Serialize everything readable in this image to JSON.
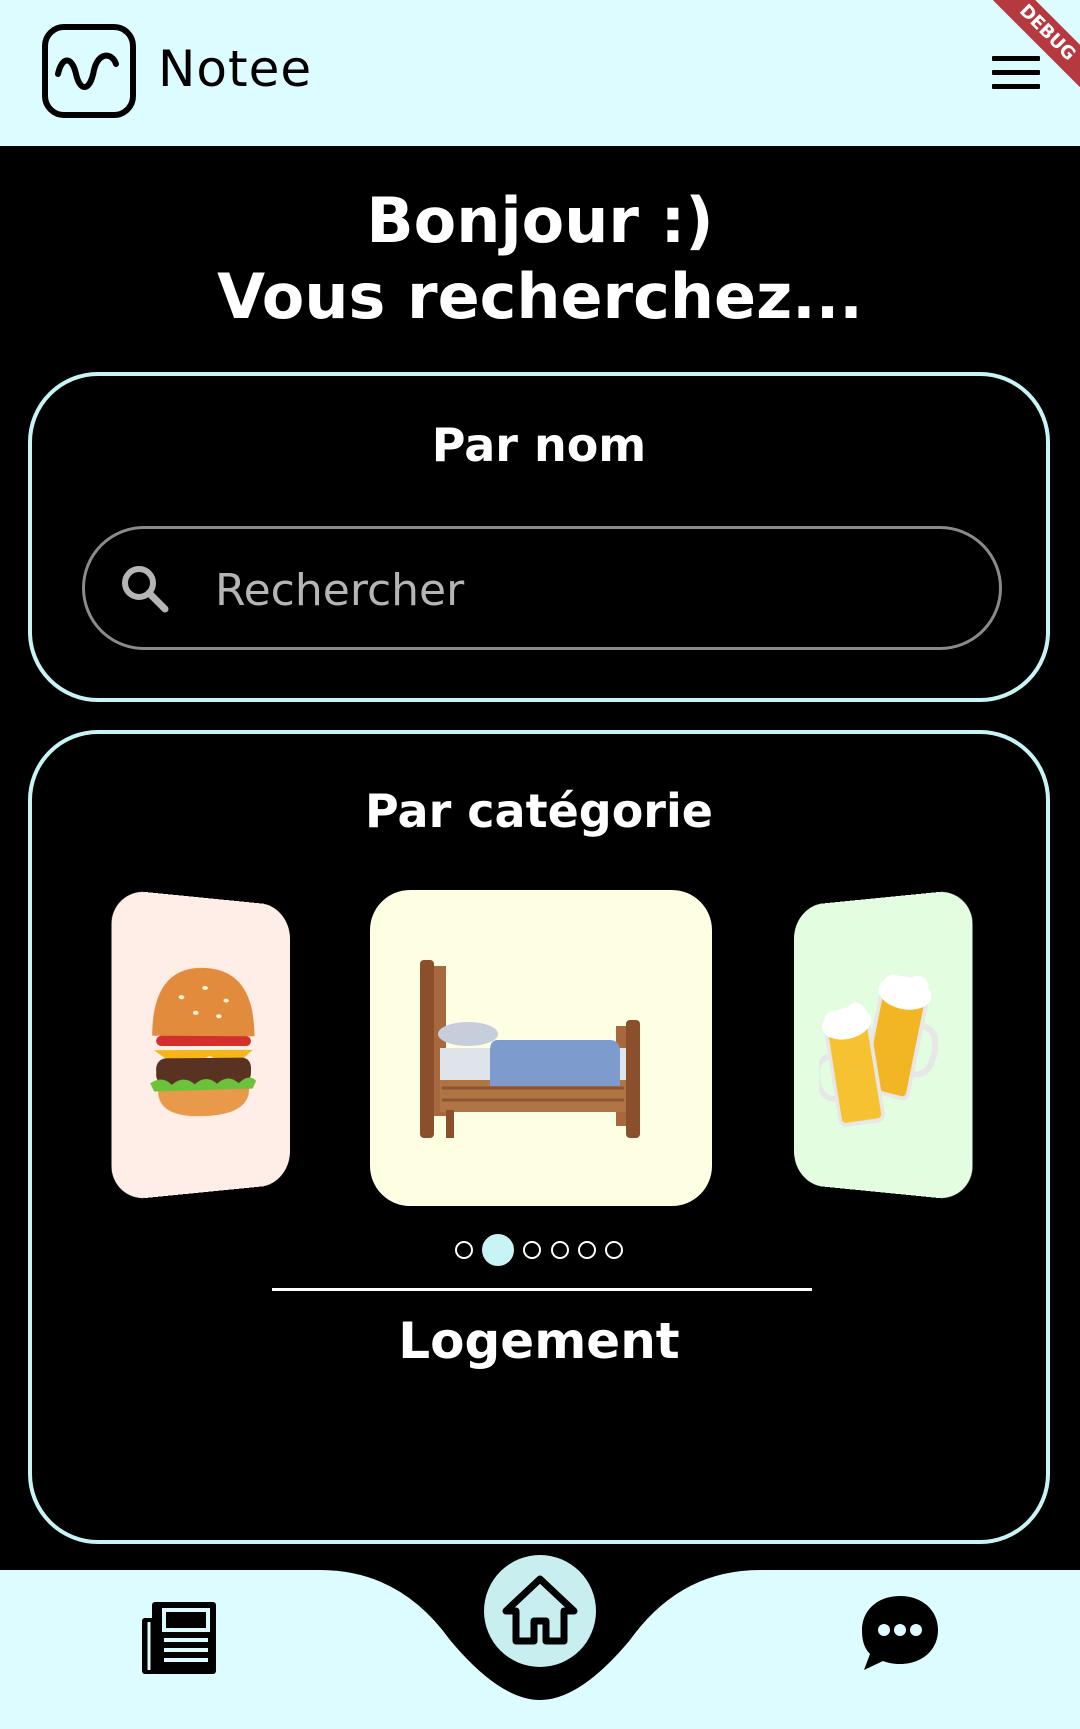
{
  "header": {
    "app_title": "Notee",
    "logo_icon": "notee-logo-icon",
    "menu_icon": "hamburger-menu-icon",
    "debug_banner": "DEBUG"
  },
  "greeting": {
    "line1": "Bonjour :)",
    "line2": "Vous recherchez..."
  },
  "search_by_name": {
    "title": "Par nom",
    "placeholder": "Rechercher",
    "value": ""
  },
  "search_by_category": {
    "title": "Par catégorie",
    "items": [
      {
        "icon": "burger-icon",
        "background": "#ffeee7"
      },
      {
        "icon": "bed-icon",
        "background": "#fefee3"
      },
      {
        "icon": "beer-mugs-icon",
        "background": "#e3fde0"
      }
    ],
    "dot_count": 6,
    "active_index": 1,
    "selected_label": "Logement"
  },
  "bottom_nav": {
    "items": [
      {
        "name": "news",
        "icon": "newspaper-icon"
      },
      {
        "name": "home",
        "icon": "home-icon"
      },
      {
        "name": "chat",
        "icon": "chat-bubble-icon"
      }
    ]
  },
  "colors": {
    "header_bg": "#dcfcff",
    "accent": "#c8f4f6",
    "page_bg": "#000000"
  }
}
